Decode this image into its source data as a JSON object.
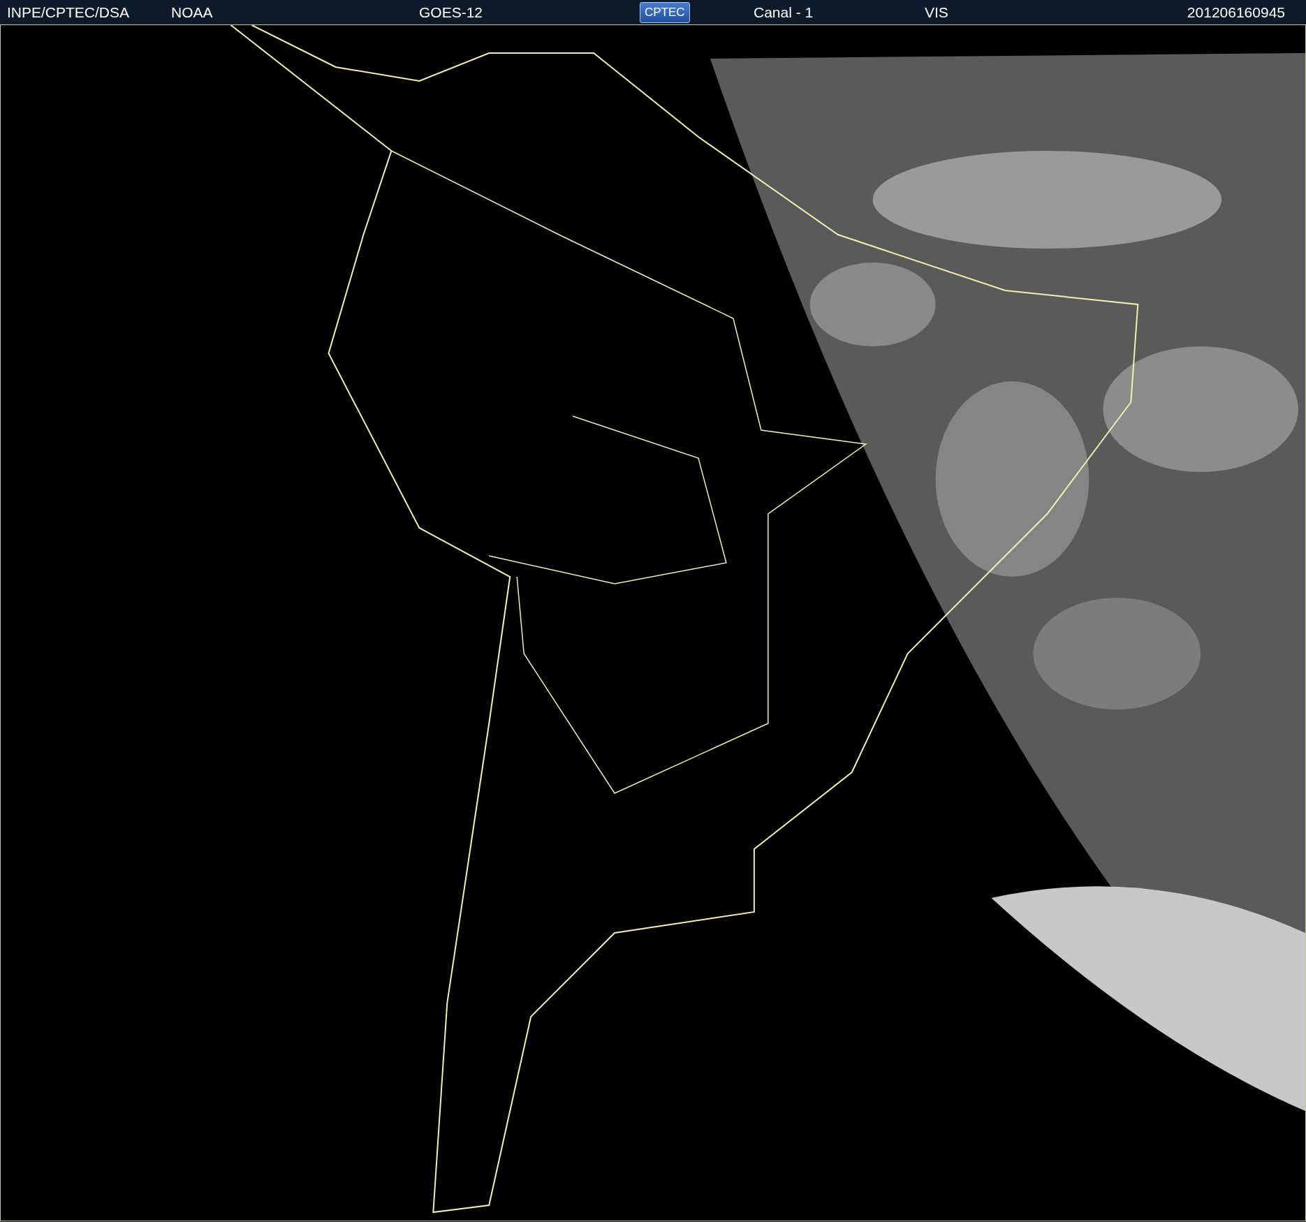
{
  "header": {
    "source": "INPE/CPTEC/DSA",
    "agency": "NOAA",
    "satellite": "GOES-12",
    "logo": "CPTEC",
    "channel": "Canal - 1",
    "band": "VIS",
    "timestamp": "201206160945"
  }
}
